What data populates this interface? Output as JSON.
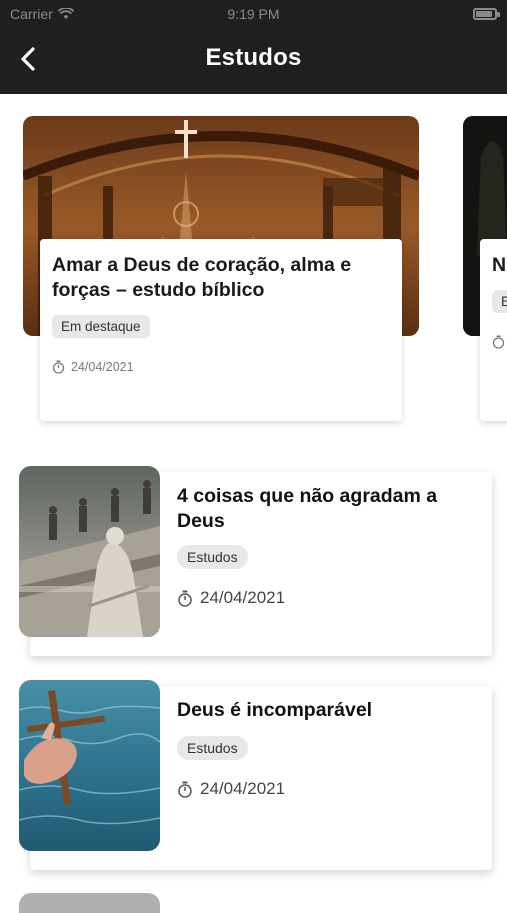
{
  "status_bar": {
    "carrier": "Carrier",
    "time": "9:19 PM"
  },
  "nav": {
    "title": "Estudos"
  },
  "featured": [
    {
      "title": "Amar a Deus de coração, alma e forças – estudo bíblico",
      "tag": "Em destaque",
      "date": "24/04/2021"
    },
    {
      "title_visible": "N m",
      "tag_visible": "E"
    }
  ],
  "articles": [
    {
      "title": "4 coisas que não agradam a Deus",
      "tag": "Estudos",
      "date": "24/04/2021"
    },
    {
      "title": "Deus é incomparável",
      "tag": "Estudos",
      "date": "24/04/2021"
    }
  ]
}
